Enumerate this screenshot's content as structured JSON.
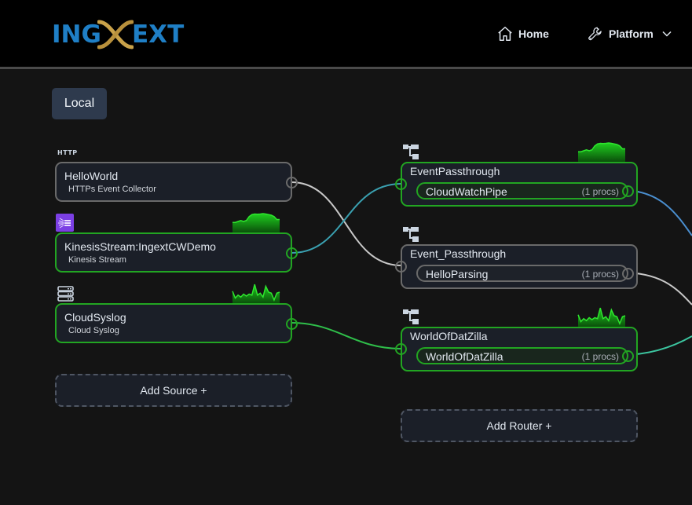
{
  "header": {
    "logo": {
      "left": "ING",
      "right": "EXT"
    },
    "nav": [
      {
        "label": "Home",
        "icon": "home-icon"
      },
      {
        "label": "Platform",
        "icon": "wrench-icon",
        "dropdown": true
      }
    ]
  },
  "environment": {
    "label": "Local"
  },
  "sources": [
    {
      "type_label": "HTTP",
      "icon": "http-label",
      "name": "HelloWorld",
      "subtitle": "HTTPs Event Collector",
      "status": "inactive",
      "sparkline": null
    },
    {
      "type_label": "",
      "icon": "kinesis-icon",
      "name": "KinesisStream:IngextCWDemo",
      "subtitle": "Kinesis Stream",
      "status": "active",
      "sparkline": [
        0.55,
        0.55,
        0.6,
        0.65,
        0.6,
        0.65,
        0.85,
        0.95,
        0.98,
        0.97,
        0.98,
        1.0,
        0.98,
        0.95,
        0.92,
        0.85,
        0.7,
        0.7
      ]
    },
    {
      "type_label": "",
      "icon": "server-icon",
      "name": "CloudSyslog",
      "subtitle": "Cloud Syslog",
      "status": "active",
      "sparkline": [
        0.65,
        0.3,
        0.45,
        0.35,
        0.5,
        0.4,
        0.5,
        0.45,
        1.0,
        0.45,
        0.55,
        0.35,
        0.9,
        0.6,
        0.55,
        0.2,
        0.55,
        0.6
      ]
    }
  ],
  "add_source_label": "Add Source +",
  "routers": [
    {
      "name": "EventPassthrough",
      "status": "active",
      "pipeline": {
        "name": "CloudWatchPipe",
        "procs": "(1 procs)"
      },
      "sparkline": [
        0.55,
        0.55,
        0.6,
        0.65,
        0.6,
        0.65,
        0.85,
        0.95,
        0.98,
        0.97,
        0.98,
        1.0,
        0.98,
        0.95,
        0.92,
        0.85,
        0.7,
        0.7
      ]
    },
    {
      "name": "Event_Passthrough",
      "status": "inactive",
      "pipeline": {
        "name": "HelloParsing",
        "procs": "(1 procs)"
      },
      "sparkline": null
    },
    {
      "name": "WorldOfDatZilla",
      "status": "active",
      "pipeline": {
        "name": "WorldOfDatZilla",
        "procs": "(1 procs)"
      },
      "sparkline": [
        0.65,
        0.3,
        0.45,
        0.35,
        0.5,
        0.4,
        0.5,
        0.45,
        1.0,
        0.45,
        0.55,
        0.35,
        0.9,
        0.6,
        0.55,
        0.2,
        0.55,
        0.6
      ]
    }
  ],
  "add_router_label": "Add Router +",
  "connections": [
    {
      "from": "HelloWorld",
      "to": "Event_Passthrough",
      "color": "#c8c8c8"
    },
    {
      "from": "KinesisStream:IngextCWDemo",
      "to": "EventPassthrough",
      "color": "#3aa0b0"
    },
    {
      "from": "CloudSyslog",
      "to": "WorldOfDatZilla",
      "color": "#2fbf4a"
    },
    {
      "from": "CloudWatchPipe",
      "to": "offscreen",
      "color": "#4a8fd0"
    },
    {
      "from": "HelloParsing",
      "to": "offscreen",
      "color": "#c8c8c8"
    },
    {
      "from": "WorldOfDatZilla",
      "to": "offscreen",
      "color": "#3cc6a0"
    }
  ],
  "colors": {
    "active_border": "#22a522",
    "inactive_border": "#6a6a6a",
    "logo_blue": "#1f7fc6",
    "logo_gold": "#c9a24a",
    "env_button": "#2e3a4d"
  }
}
